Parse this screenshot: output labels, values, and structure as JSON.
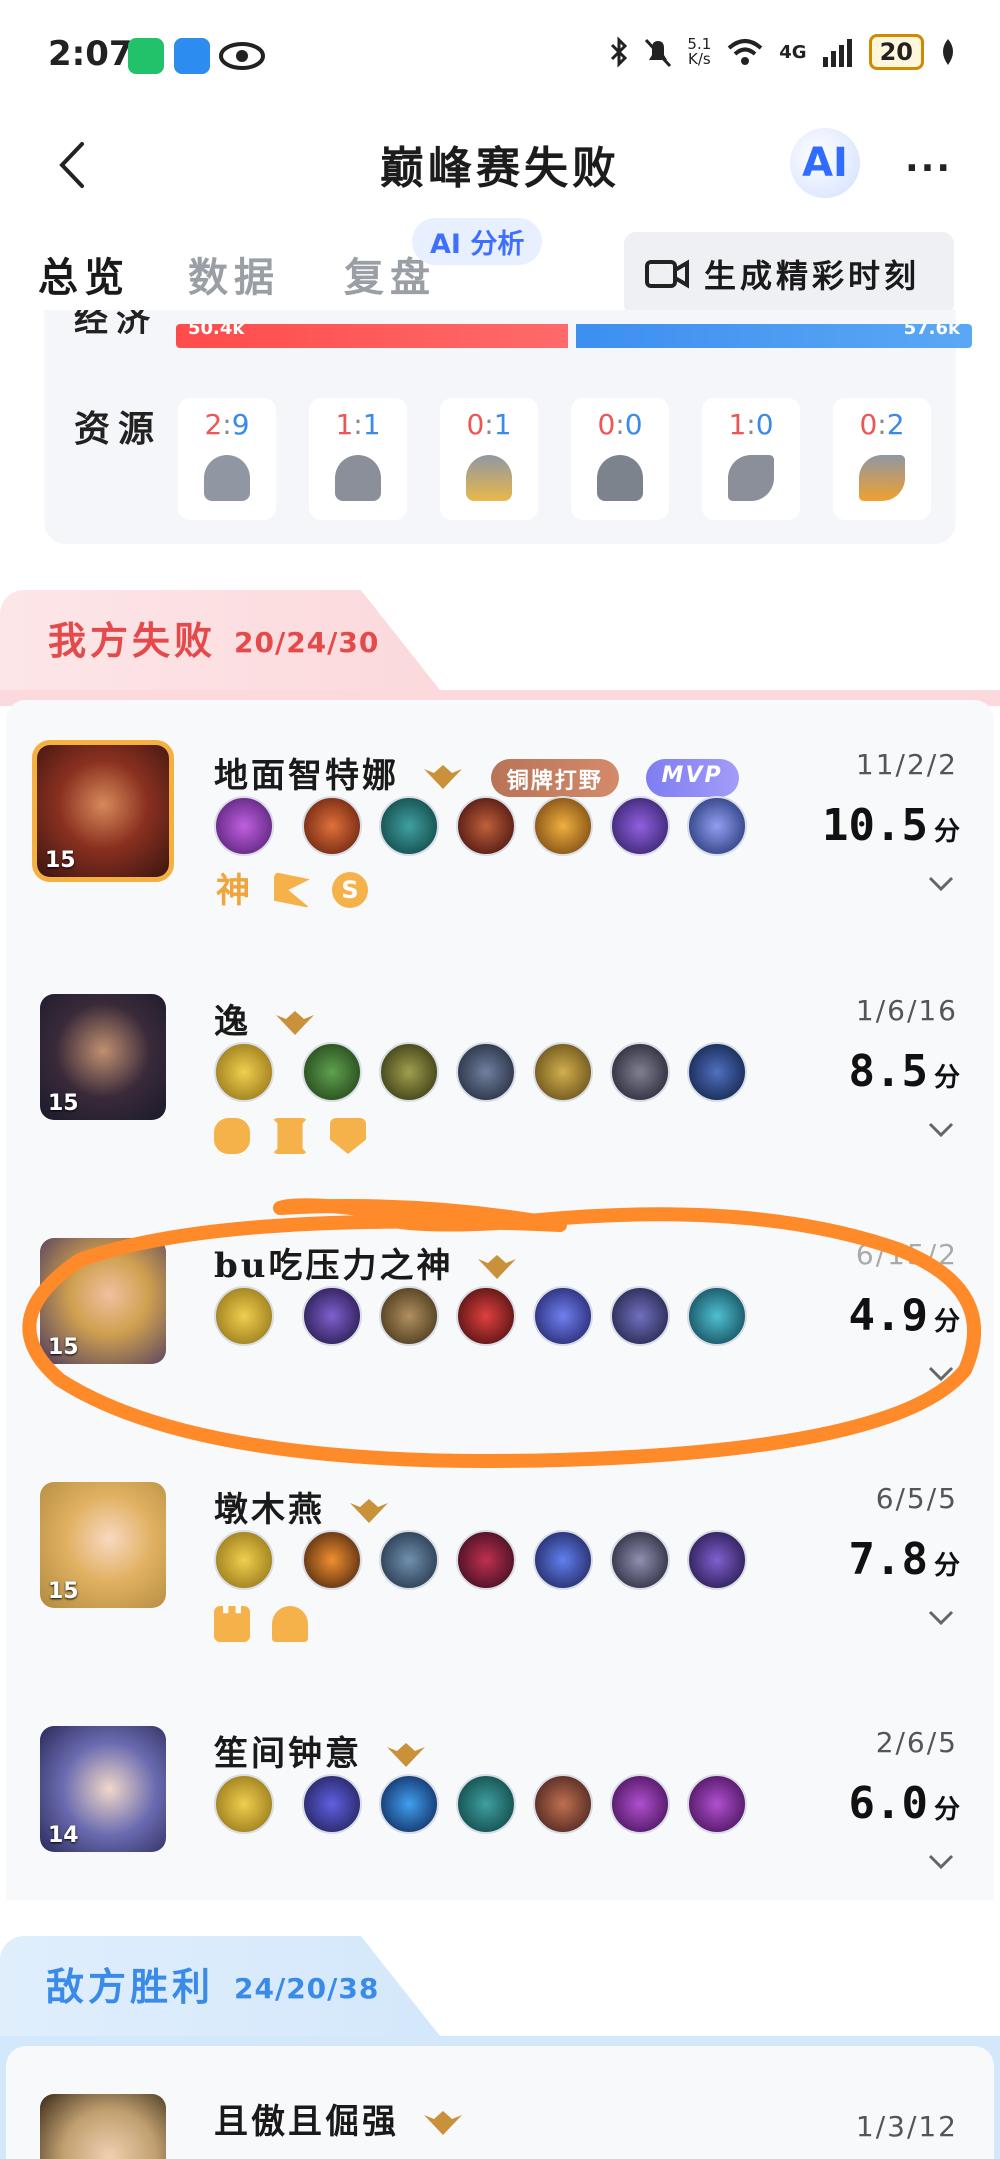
{
  "status_bar": {
    "time": "2:07",
    "net_speed_top": "5.1",
    "net_speed_bottom": "K/s",
    "wifi_label": "6",
    "cell_label": "4G",
    "battery": "20"
  },
  "header": {
    "title": "巅峰赛失败",
    "ai_label": "AI",
    "more_label": "···"
  },
  "tabs": [
    {
      "label": "总览",
      "active": true
    },
    {
      "label": "数据",
      "active": false
    },
    {
      "label": "复盘",
      "active": false
    }
  ],
  "ai_analysis_label": "AI 分析",
  "generate_button_label": "生成精彩时刻",
  "summary": {
    "economy_label": "经济",
    "economy_left": "50.4k",
    "economy_right": "57.6k",
    "economy_left_value": 50.4,
    "economy_right_value": 57.6,
    "resources_label": "资源",
    "resources": [
      {
        "left": "2",
        "sep": ":",
        "right": "9",
        "icon": "overlord-icon"
      },
      {
        "left": "1",
        "sep": ":",
        "right": "1",
        "icon": "dragon-icon"
      },
      {
        "left": "0",
        "sep": ":",
        "right": "1",
        "icon": "storm-dragon-icon"
      },
      {
        "left": "0",
        "sep": ":",
        "right": "0",
        "icon": "dark-tyrant-icon"
      },
      {
        "left": "1",
        "sep": ":",
        "right": "0",
        "icon": "shadow-vanguard-icon"
      },
      {
        "left": "0",
        "sep": ":",
        "right": "2",
        "icon": "fire-vanguard-icon"
      }
    ]
  },
  "team_red": {
    "title": "我方失败",
    "kda": "20/24/30",
    "color": "#e54a4a",
    "players": [
      {
        "name": "地面智特娜",
        "level": "15",
        "kda": "11/2/2",
        "score": "10.5",
        "score_unit": "分",
        "tag": "铜牌打野",
        "mvp": "MVP",
        "badges": [
          "神",
          "flag",
          "S"
        ],
        "items": [
          "#7a3fa0",
          "#b84020",
          "#1e6f70",
          "#8a2e1a",
          "#c98a20",
          "#6a3ab0",
          "#5a6ad0"
        ]
      },
      {
        "name": "逸",
        "level": "15",
        "kda": "1/6/16",
        "score": "8.5",
        "score_unit": "分",
        "badges": [
          "fist",
          "pillar",
          "shield"
        ],
        "items": [
          "#d9a520",
          "#3a7a30",
          "#5a5a20",
          "#3a4a6a",
          "#b08a20",
          "#3a3a5a",
          "#2a4a8a"
        ]
      },
      {
        "name": "bu吃压力之神",
        "level": "15",
        "kda": "6/15/2",
        "score": "4.9",
        "score_unit": "分",
        "badges": [],
        "items": [
          "#d9a520",
          "#4a3aa0",
          "#8a6a30",
          "#c02020",
          "#4a4ad0",
          "#3a3a8a",
          "#2a7a8a"
        ]
      },
      {
        "name": "墩木燕",
        "level": "15",
        "kda": "6/5/5",
        "score": "7.8",
        "score_unit": "分",
        "badges": [
          "tower",
          "helmet"
        ],
        "items": [
          "#d9a520",
          "#c86a10",
          "#4a6a8a",
          "#8a2040",
          "#3a5ad0",
          "#4a4a7a",
          "#4a3aa0"
        ]
      },
      {
        "name": "笙间钟意",
        "level": "14",
        "kda": "2/6/5",
        "score": "6.0",
        "score_unit": "分",
        "badges": [],
        "items": [
          "#d9a520",
          "#3a3aa0",
          "#2a6ad0",
          "#2a6a6a",
          "#8a3a2a",
          "#7a2a9a",
          "#7a2a9a"
        ]
      }
    ]
  },
  "team_blue": {
    "title": "敌方胜利",
    "kda": "24/20/38",
    "color": "#3a8ae8",
    "players": [
      {
        "name": "且傲且倔强",
        "kda": "1/3/12"
      }
    ]
  }
}
